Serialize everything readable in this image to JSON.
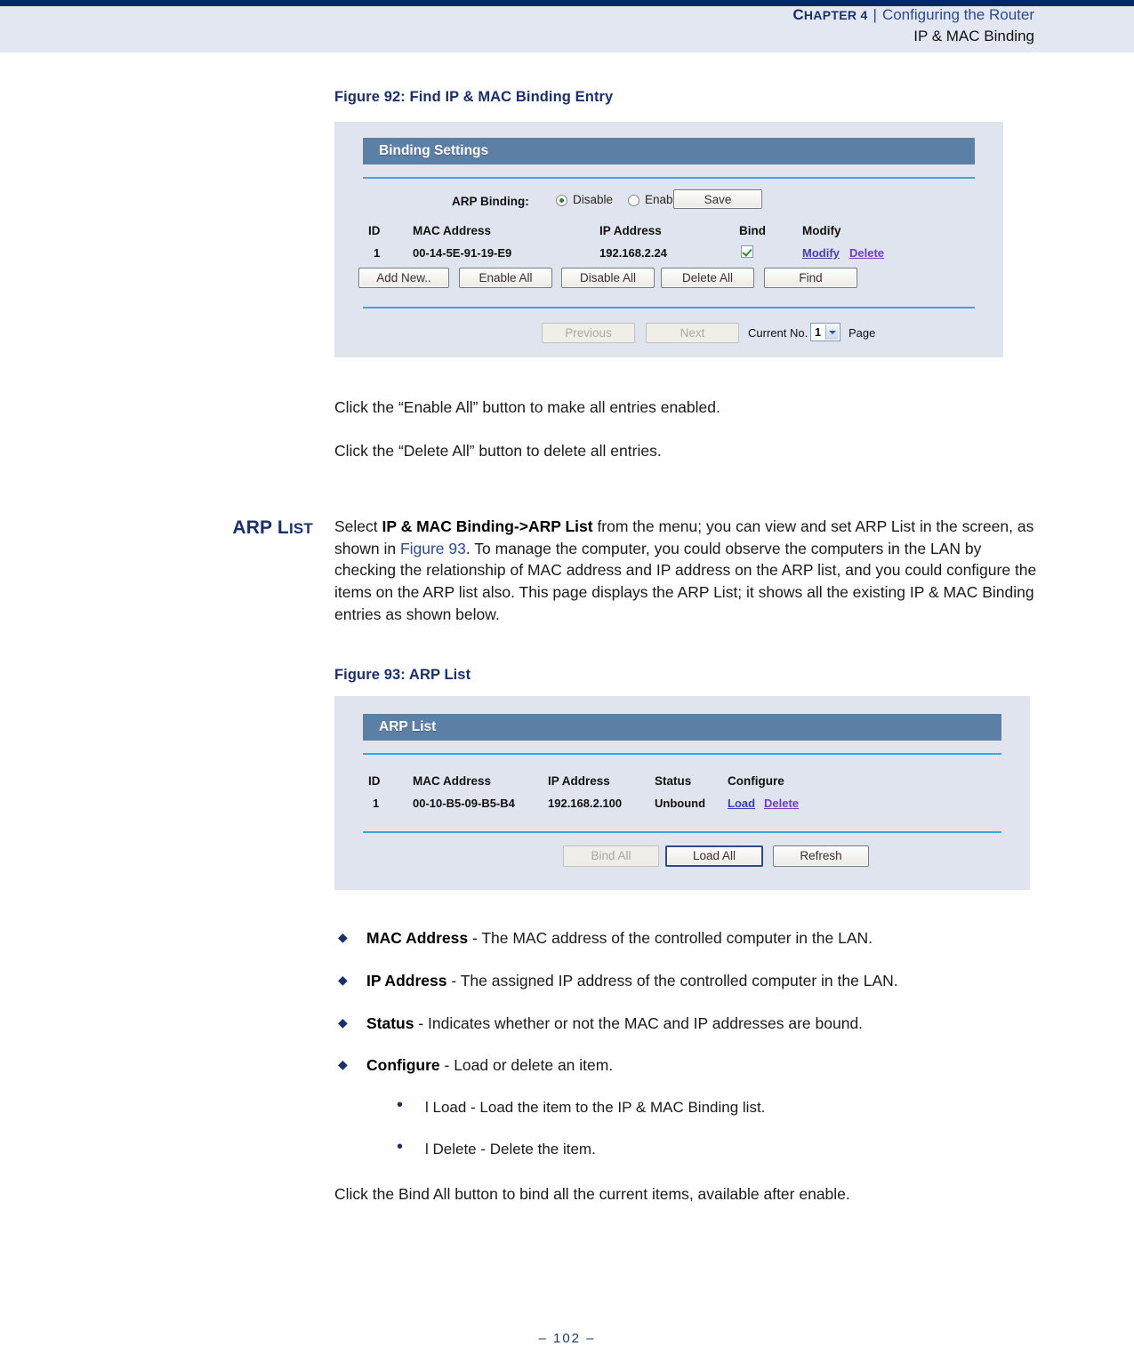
{
  "header": {
    "chapter": "Chapter 4",
    "chapter_lead": "C",
    "chapter_rest": "HAPTER 4",
    "separator": "|",
    "section": "Configuring the Router",
    "subsection": "IP & MAC Binding"
  },
  "figure92": {
    "caption": "Figure 92:  Find IP & MAC Binding Entry",
    "panel_title": "Binding Settings",
    "arp_binding_label": "ARP Binding:",
    "radios": [
      {
        "label": "Disable",
        "selected": true
      },
      {
        "label": "Enable",
        "selected": false
      }
    ],
    "save_button": "Save",
    "columns": [
      "ID",
      "MAC Address",
      "IP Address",
      "Bind",
      "Modify"
    ],
    "row": {
      "id": "1",
      "mac": "00-14-5E-91-19-E9",
      "ip": "192.168.2.24",
      "bind_checked": true,
      "modify_link": "Modify",
      "delete_link": "Delete"
    },
    "buttons": [
      "Add New..",
      "Enable All",
      "Disable All",
      "Delete All",
      "Find"
    ],
    "pagination": {
      "previous": "Previous",
      "previous_disabled": true,
      "next": "Next",
      "next_disabled": true,
      "current_label": "Current No.",
      "current_value": "1",
      "page_label": "Page"
    }
  },
  "figure93": {
    "caption": "Figure 93:  ARP List",
    "panel_title": "ARP List",
    "columns": [
      "ID",
      "MAC Address",
      "IP Address",
      "Status",
      "Configure"
    ],
    "row": {
      "id": "1",
      "mac": "00-10-B5-09-B5-B4",
      "ip": "192.168.2.100",
      "status": "Unbound",
      "load_link": "Load",
      "delete_link": "Delete"
    },
    "buttons": [
      {
        "label": "Bind All",
        "disabled": true,
        "focused": false
      },
      {
        "label": "Load All",
        "disabled": false,
        "focused": true
      },
      {
        "label": "Refresh",
        "disabled": false,
        "focused": false
      }
    ]
  },
  "body": {
    "para_enable_all": "Click the “Enable All” button to make all entries enabled.",
    "para_delete_all": "Click the “Delete All” button to delete all entries.",
    "side_head": "ARP LIST",
    "side_head_lead1": "ARP L",
    "side_head_rest": "IST",
    "arp_list_para": {
      "p1": "Select ",
      "bold1": "IP & MAC Binding->ARP List",
      "p2": " from the menu; you can view and set ARP List in the screen, as shown in ",
      "link": "Figure 93",
      "p3": ". To manage the computer, you could observe the computers in the LAN by checking the relationship of MAC address and IP address on the ARP list, and you could configure the items on the ARP list also. This page displays the ARP List; it shows all the existing IP & MAC Binding entries as shown below."
    },
    "bullets": [
      {
        "term": "MAC Address",
        "desc": " - The MAC address of the controlled computer in the LAN."
      },
      {
        "term": "IP Address",
        "desc": " - The assigned IP address of the controlled computer in the LAN."
      },
      {
        "term": "Status",
        "desc": " - Indicates whether or not the MAC and IP addresses are bound."
      },
      {
        "term": "Configure",
        "desc": " - Load or delete an item."
      }
    ],
    "sub_bullets": [
      "l Load - Load the item to the IP & MAC Binding list.",
      "l Delete - Delete the item."
    ],
    "closing_para": "Click the Bind All button to bind all the current items, available after enable."
  },
  "footer": {
    "page_number": "–  102  –"
  },
  "colors": {
    "navy": "#00276b",
    "header_band": "#e3e7f1",
    "panel_header": "#5c7fa6",
    "panel_bg": "#dfe4ef",
    "rule_cyan": "#3ba7dd",
    "heading_blue": "#1b2f6b"
  }
}
